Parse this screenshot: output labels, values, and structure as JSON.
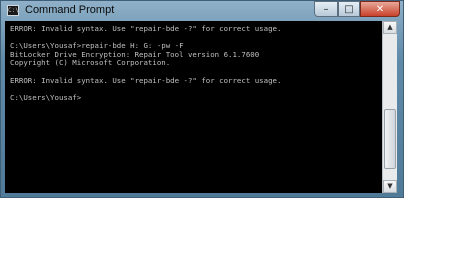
{
  "window": {
    "title": "Command Prompt",
    "icon_text": "C:\\",
    "buttons": {
      "minimize": "–",
      "maximize": "□",
      "close": "✕"
    }
  },
  "console": {
    "text": "ERROR: Invalid syntax. Use \"repair-bde -?\" for correct usage.\n\nC:\\Users\\Yousaf>repair-bde H: G: -pw -F\nBitLocker Drive Encryption: Repair Tool version 6.1.7600\nCopyright (C) Microsoft Corporation.\n\nERROR: Invalid syntax. Use \"repair-bde -?\" for correct usage.\n\nC:\\Users\\Yousaf>"
  },
  "scrollbar": {
    "up": "▲",
    "down": "▼"
  },
  "colors": {
    "console_bg": "#000000",
    "console_text": "#c0c0c0",
    "frame": "#5f8aa8"
  }
}
